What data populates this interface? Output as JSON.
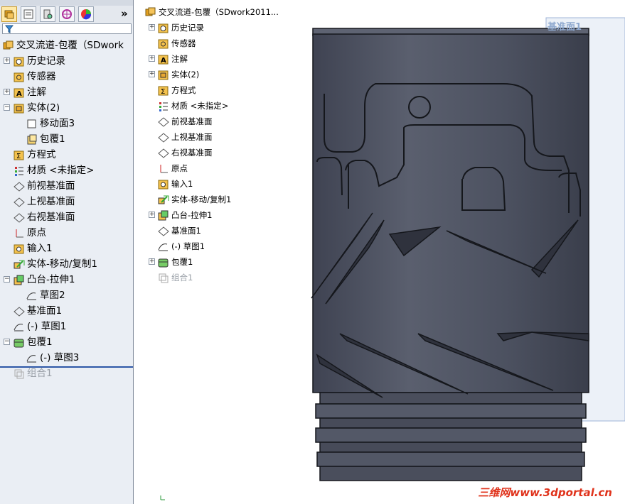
{
  "left_panel": {
    "toolbar": {
      "icons": [
        "featuremanager-icon",
        "propertymanager-icon",
        "configurationmanager-icon",
        "dimxpert-icon",
        "display-manager-icon"
      ],
      "expand_glyph": "»"
    },
    "tree": [
      {
        "label": "交叉流道-包覆（SDwork",
        "icon": "part-icon"
      },
      {
        "label": "历史记录",
        "icon": "history-icon",
        "expand": "+"
      },
      {
        "label": "传感器",
        "icon": "sensor-icon"
      },
      {
        "label": "注解",
        "icon": "annotation-icon",
        "expand": "+"
      },
      {
        "label": "实体(2)",
        "icon": "solid-bodies-icon",
        "expand": "-"
      },
      {
        "label": "移动面3",
        "icon": "move-face-icon"
      },
      {
        "label": "包覆1",
        "icon": "wrap-body-icon"
      },
      {
        "label": "方程式",
        "icon": "equation-icon"
      },
      {
        "label": "材质 <未指定>",
        "icon": "material-icon"
      },
      {
        "label": "前视基准面",
        "icon": "plane-icon"
      },
      {
        "label": "上视基准面",
        "icon": "plane-icon"
      },
      {
        "label": "右视基准面",
        "icon": "plane-icon"
      },
      {
        "label": "原点",
        "icon": "origin-icon"
      },
      {
        "label": "输入1",
        "icon": "import-icon"
      },
      {
        "label": "实体-移动/复制1",
        "icon": "move-copy-icon"
      },
      {
        "label": "凸台-拉伸1",
        "icon": "extrude-icon",
        "expand": "-"
      },
      {
        "label": "草图2",
        "icon": "sketch-icon"
      },
      {
        "label": "基准面1",
        "icon": "plane-icon"
      },
      {
        "label": "(-) 草图1",
        "icon": "sketch-icon"
      },
      {
        "label": "包覆1",
        "icon": "wrap-icon",
        "expand": "-"
      },
      {
        "label": "(-) 草图3",
        "icon": "sketch-icon"
      },
      {
        "label": "组合1",
        "icon": "combine-icon"
      }
    ]
  },
  "mid_tree": {
    "items": [
      {
        "label": "交叉流道-包覆（SDwork2011...",
        "icon": "part-icon"
      },
      {
        "label": "历史记录",
        "icon": "history-icon",
        "expand": "+"
      },
      {
        "label": "传感器",
        "icon": "sensor-icon"
      },
      {
        "label": "注解",
        "icon": "annotation-icon",
        "expand": "+"
      },
      {
        "label": "实体(2)",
        "icon": "solid-bodies-icon",
        "expand": "+"
      },
      {
        "label": "方程式",
        "icon": "equation-icon"
      },
      {
        "label": "材质 <未指定>",
        "icon": "material-icon"
      },
      {
        "label": "前视基准面",
        "icon": "plane-icon"
      },
      {
        "label": "上视基准面",
        "icon": "plane-icon"
      },
      {
        "label": "右视基准面",
        "icon": "plane-icon"
      },
      {
        "label": "原点",
        "icon": "origin-icon"
      },
      {
        "label": "输入1",
        "icon": "import-icon"
      },
      {
        "label": "实体-移动/复制1",
        "icon": "move-copy-icon"
      },
      {
        "label": "凸台-拉伸1",
        "icon": "extrude-icon",
        "expand": "+"
      },
      {
        "label": "基准面1",
        "icon": "plane-icon"
      },
      {
        "label": "(-) 草图1",
        "icon": "sketch-icon"
      },
      {
        "label": "包覆1",
        "icon": "wrap-icon",
        "expand": "+"
      },
      {
        "label": "组合1",
        "icon": "combine-icon"
      }
    ]
  },
  "viewport": {
    "plane_label": "基准面1",
    "watermark": "三维网www.3dportal.cn",
    "colors": {
      "body": "#4e5361",
      "body_dark": "#3a3e4a",
      "edge": "#15171c",
      "plane": "#c8d6ec"
    }
  }
}
